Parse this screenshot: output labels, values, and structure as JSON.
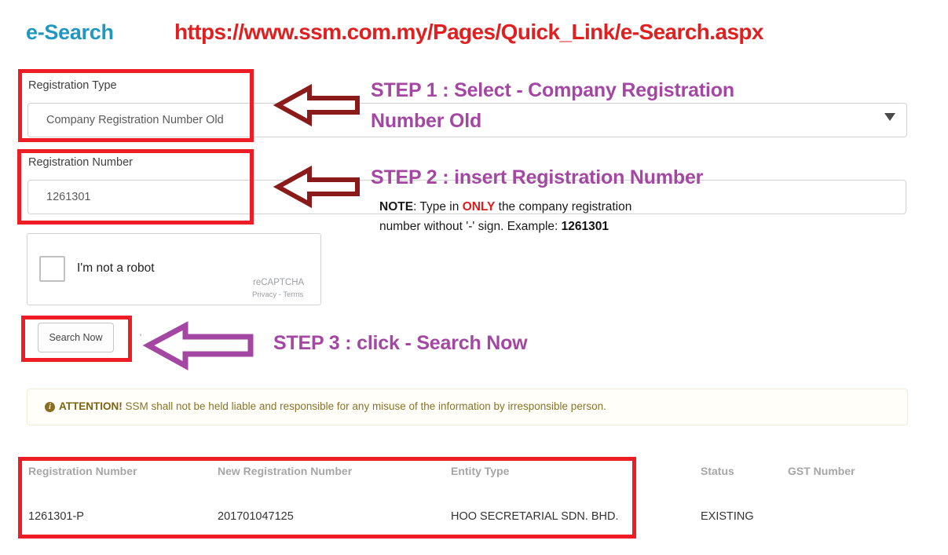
{
  "header": {
    "logo": "e-Search",
    "url": "https://www.ssm.com.my/Pages/Quick_Link/e-Search.aspx"
  },
  "form": {
    "registration_type": {
      "label": "Registration Type",
      "selected_value": "Company Registration Number Old",
      "caret_icon": "chevron-down-icon"
    },
    "registration_number": {
      "label": "Registration Number",
      "value": "1261301"
    },
    "recaptcha": {
      "checkbox_label": "I'm not a robot",
      "brand": "reCAPTCHA",
      "legal": "Privacy - Terms"
    },
    "search_button": "Search Now",
    "stray_mark": "'"
  },
  "annotations": {
    "step1_line1": "STEP 1 : Select - Company Registration",
    "step1_line2": "Number Old",
    "step2": "STEP 2 : insert Registration Number",
    "step3": "STEP 3 : click - Search Now",
    "note": {
      "label": "NOTE",
      "text_before": ": Type in ",
      "emphasis": "ONLY",
      "text_after": " the company registration",
      "line2_before": "number without '-' sign. Example:  ",
      "line2_example": "1261301"
    },
    "colors": {
      "step_text": "#a347a3",
      "arrow_maroon": "#8b1a1a",
      "arrow_purple": "#a347a3",
      "highlight_box": "#ee1c25"
    }
  },
  "attention": {
    "icon": "info-circle-icon",
    "icon_glyph": "i",
    "title": "ATTENTION!",
    "message": " SSM shall not be held liable and responsible for any misuse of the information by irresponsible person."
  },
  "results": {
    "headers": [
      "Registration Number",
      "New Registration Number",
      "Entity Type",
      "Status",
      "GST Number"
    ],
    "rows": [
      {
        "registration_number": "1261301-P",
        "new_registration_number": "201701047125",
        "entity_type": "HOO SECRETARIAL SDN. BHD.",
        "status": "EXISTING",
        "gst_number": ""
      }
    ]
  }
}
